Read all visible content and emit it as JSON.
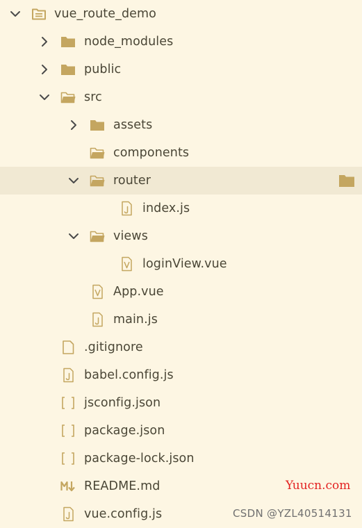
{
  "colors": {
    "background": "#fdf6e3",
    "selected_row": "#f1e9d3",
    "icon": "#c4a660",
    "text": "#4a4636",
    "watermark_site": "#e32222"
  },
  "tree": [
    {
      "label": "vue_route_demo",
      "kind": "root",
      "icon": "root-folder-icon",
      "chevron": "down"
    },
    {
      "label": "node_modules",
      "kind": "folder",
      "icon": "folder-icon",
      "chevron": "right"
    },
    {
      "label": "public",
      "kind": "folder",
      "icon": "folder-icon",
      "chevron": "right"
    },
    {
      "label": "src",
      "kind": "folder-open",
      "icon": "folder-open-icon",
      "chevron": "down"
    },
    {
      "label": "assets",
      "kind": "folder",
      "icon": "folder-icon",
      "chevron": "right"
    },
    {
      "label": "components",
      "kind": "folder-open",
      "icon": "folder-open-icon",
      "chevron": "none"
    },
    {
      "label": "router",
      "kind": "folder-open",
      "icon": "folder-open-icon",
      "chevron": "down",
      "selected": true
    },
    {
      "label": "index.js",
      "kind": "js",
      "icon": "js-file-icon",
      "chevron": "none"
    },
    {
      "label": "views",
      "kind": "folder-open",
      "icon": "folder-open-icon",
      "chevron": "down"
    },
    {
      "label": "loginView.vue",
      "kind": "vue",
      "icon": "vue-file-icon",
      "chevron": "none"
    },
    {
      "label": "App.vue",
      "kind": "vue",
      "icon": "vue-file-icon",
      "chevron": "none"
    },
    {
      "label": "main.js",
      "kind": "js",
      "icon": "js-file-icon",
      "chevron": "none"
    },
    {
      "label": ".gitignore",
      "kind": "file",
      "icon": "file-icon",
      "chevron": "none"
    },
    {
      "label": "babel.config.js",
      "kind": "js",
      "icon": "js-file-icon",
      "chevron": "none"
    },
    {
      "label": "jsconfig.json",
      "kind": "json",
      "icon": "json-file-icon",
      "chevron": "none"
    },
    {
      "label": "package.json",
      "kind": "json",
      "icon": "json-file-icon",
      "chevron": "none"
    },
    {
      "label": "package-lock.json",
      "kind": "json",
      "icon": "json-file-icon",
      "chevron": "none"
    },
    {
      "label": "README.md",
      "kind": "md",
      "icon": "markdown-file-icon",
      "chevron": "none"
    },
    {
      "label": "vue.config.js",
      "kind": "js",
      "icon": "js-file-icon",
      "chevron": "none"
    }
  ],
  "watermark": {
    "site": "Yuucn.com",
    "author": "CSDN @YZL40514131"
  }
}
